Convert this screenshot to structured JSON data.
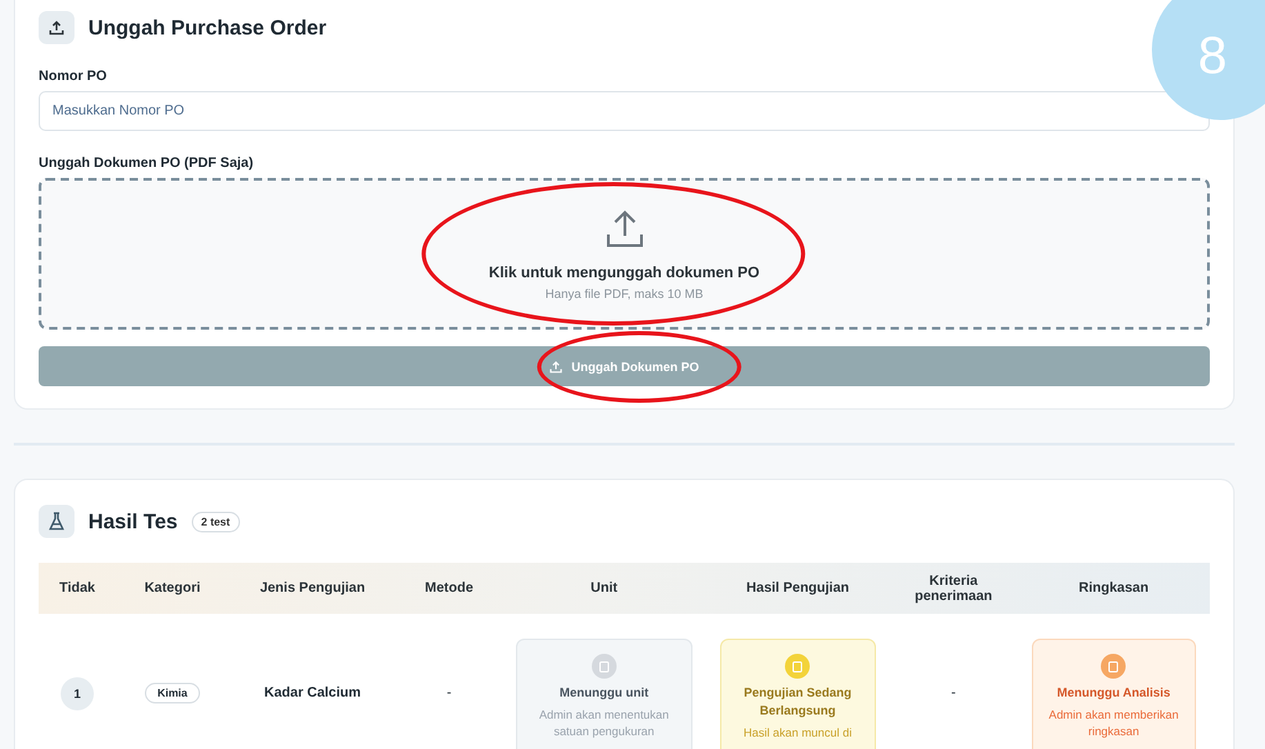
{
  "step_badge": "8",
  "upload_po": {
    "title": "Unggah Purchase Order",
    "po_number": {
      "label": "Nomor PO",
      "placeholder": "Masukkan Nomor PO"
    },
    "document": {
      "label": "Unggah Dokumen PO (PDF Saja)",
      "prompt": "Klik untuk mengunggah dokumen PO",
      "hint": "Hanya file PDF, maks 10 MB",
      "highlighted": true
    },
    "submit_button": {
      "label": "Unggah Dokumen PO",
      "disabled": true,
      "highlighted": true
    }
  },
  "test_results": {
    "title": "Hasil Tes",
    "count": "2 test",
    "columns": [
      "Tidak",
      "Kategori",
      "Jenis Pengujian",
      "Metode",
      "Unit",
      "Hasil Pengujian",
      "Kriteria penerimaan",
      "Ringkasan"
    ],
    "rows": [
      {
        "no": "1",
        "category": "Kimia",
        "test_type": "Kadar Calcium",
        "method": "-",
        "unit": {
          "kind": "waiting",
          "title": "Menunggu unit",
          "note": "Admin akan menentukan satuan pengukuran"
        },
        "result": {
          "kind": "in-progress",
          "title": "Pengujian Sedang Berlangsung",
          "note": "Hasil akan muncul di"
        },
        "criteria": "-",
        "summary": {
          "kind": "analysis",
          "title": "Menunggu Analisis",
          "note": "Admin akan memberikan ringkasan"
        }
      }
    ]
  }
}
